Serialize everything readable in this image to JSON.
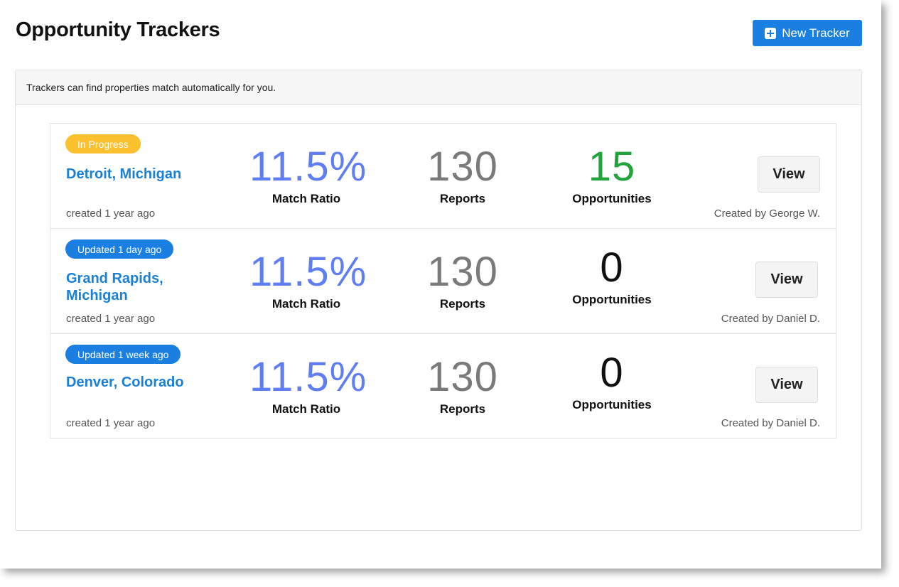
{
  "header": {
    "title": "Opportunity Trackers",
    "new_button_label": "New Tracker"
  },
  "panel": {
    "info_text": "Trackers can find properties match automatically for you."
  },
  "trackers": [
    {
      "badge": "In Progress",
      "badge_color": "#fbc02d",
      "location": "Detroit, Michigan",
      "created": "created 1 year ago",
      "match_ratio": "11.5%",
      "match_ratio_label": "Match Ratio",
      "reports": "130",
      "reports_label": "Reports",
      "opportunities": "15",
      "opportunities_label": "Opportunities",
      "opportunities_color": "#22a33b",
      "view_label": "View",
      "creator": "Created by George W."
    },
    {
      "badge": "Updated 1 day ago",
      "badge_color": "#1a7fe0",
      "location": "Grand Rapids, Michigan",
      "created": "created 1 year ago",
      "match_ratio": "11.5%",
      "match_ratio_label": "Match Ratio",
      "reports": "130",
      "reports_label": "Reports",
      "opportunities": "0",
      "opportunities_label": "Opportunities",
      "opportunities_color": "#111111",
      "view_label": "View",
      "creator": "Created by Daniel D."
    },
    {
      "badge": "Updated 1 week ago",
      "badge_color": "#1a7fe0",
      "location": "Denver, Colorado",
      "created": "created 1 year ago",
      "match_ratio": "11.5%",
      "match_ratio_label": "Match Ratio",
      "reports": "130",
      "reports_label": "Reports",
      "opportunities": "0",
      "opportunities_label": "Opportunities",
      "opportunities_color": "#111111",
      "view_label": "View",
      "creator": "Created by Daniel D."
    }
  ],
  "colors": {
    "accent": "#1a7fe0",
    "match_ratio": "#5f7ef2",
    "reports": "#7a7a7a"
  }
}
